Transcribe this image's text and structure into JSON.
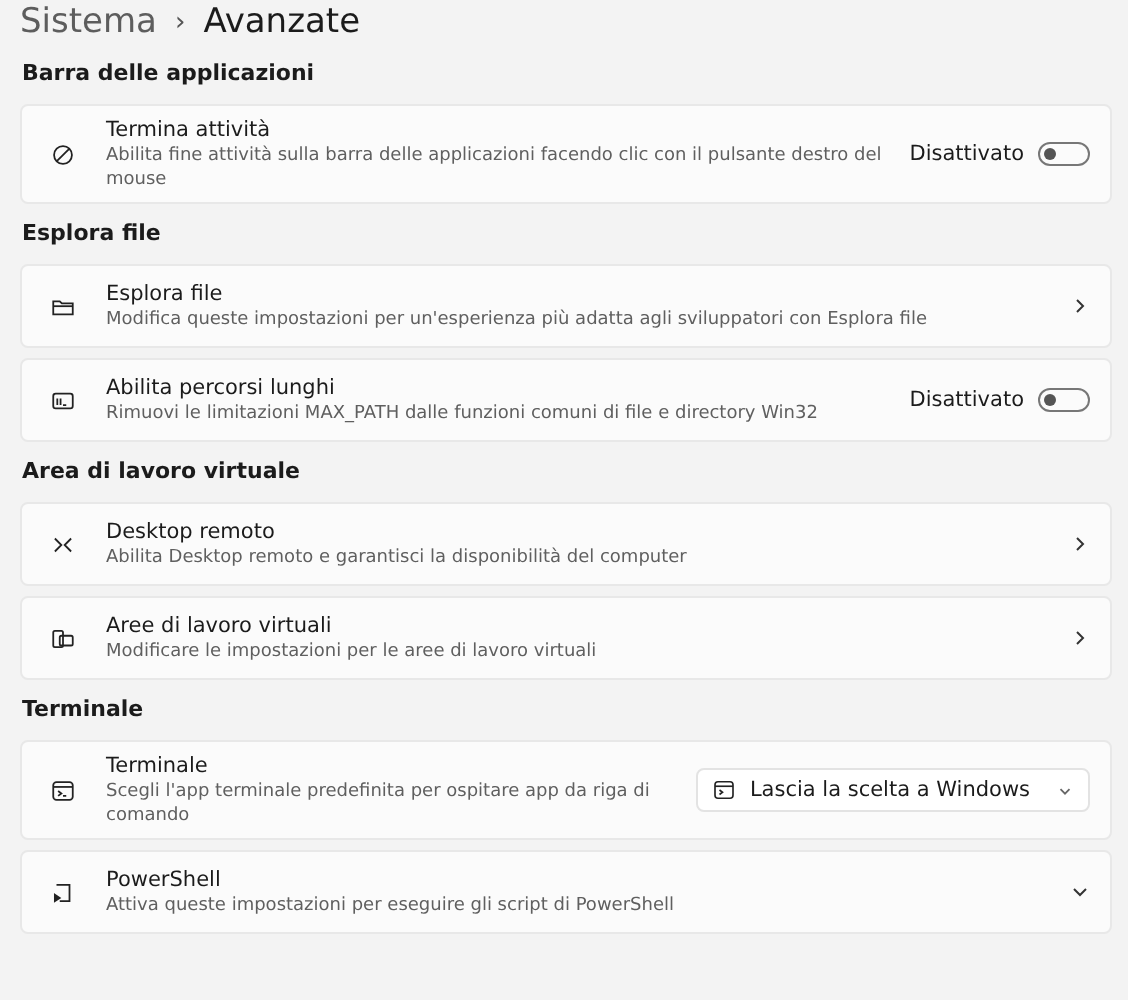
{
  "breadcrumb": {
    "parent": "Sistema",
    "separator": "›",
    "current": "Avanzate"
  },
  "sections": [
    {
      "heading": "Barra delle applicazioni",
      "items": [
        {
          "kind": "toggle",
          "title": "Termina attività",
          "description": "Abilita fine attività sulla barra delle applicazioni facendo clic con il pulsante destro del mouse",
          "state_label": "Disattivato",
          "on": false
        }
      ]
    },
    {
      "heading": "Esplora file",
      "items": [
        {
          "kind": "link",
          "title": "Esplora file",
          "description": "Modifica queste impostazioni per un'esperienza più adatta agli sviluppatori con Esplora file"
        },
        {
          "kind": "toggle",
          "title": "Abilita percorsi lunghi",
          "description": "Rimuovi le limitazioni MAX_PATH dalle funzioni comuni di file e directory Win32",
          "state_label": "Disattivato",
          "on": false
        }
      ]
    },
    {
      "heading": "Area di lavoro virtuale",
      "items": [
        {
          "kind": "link",
          "title": "Desktop remoto",
          "description": "Abilita Desktop remoto e garantisci la disponibilità del computer"
        },
        {
          "kind": "link",
          "title": "Aree di lavoro virtuali",
          "description": "Modificare le impostazioni per le aree di lavoro virtuali"
        }
      ]
    },
    {
      "heading": "Terminale",
      "items": [
        {
          "kind": "dropdown",
          "title": "Terminale",
          "description": "Scegli l'app terminale predefinita per ospitare app da riga di comando",
          "value": "Lascia la scelta a Windows"
        },
        {
          "kind": "expander",
          "title": "PowerShell",
          "description": "Attiva queste impostazioni per eseguire gli script di PowerShell",
          "expanded": false
        }
      ]
    }
  ]
}
